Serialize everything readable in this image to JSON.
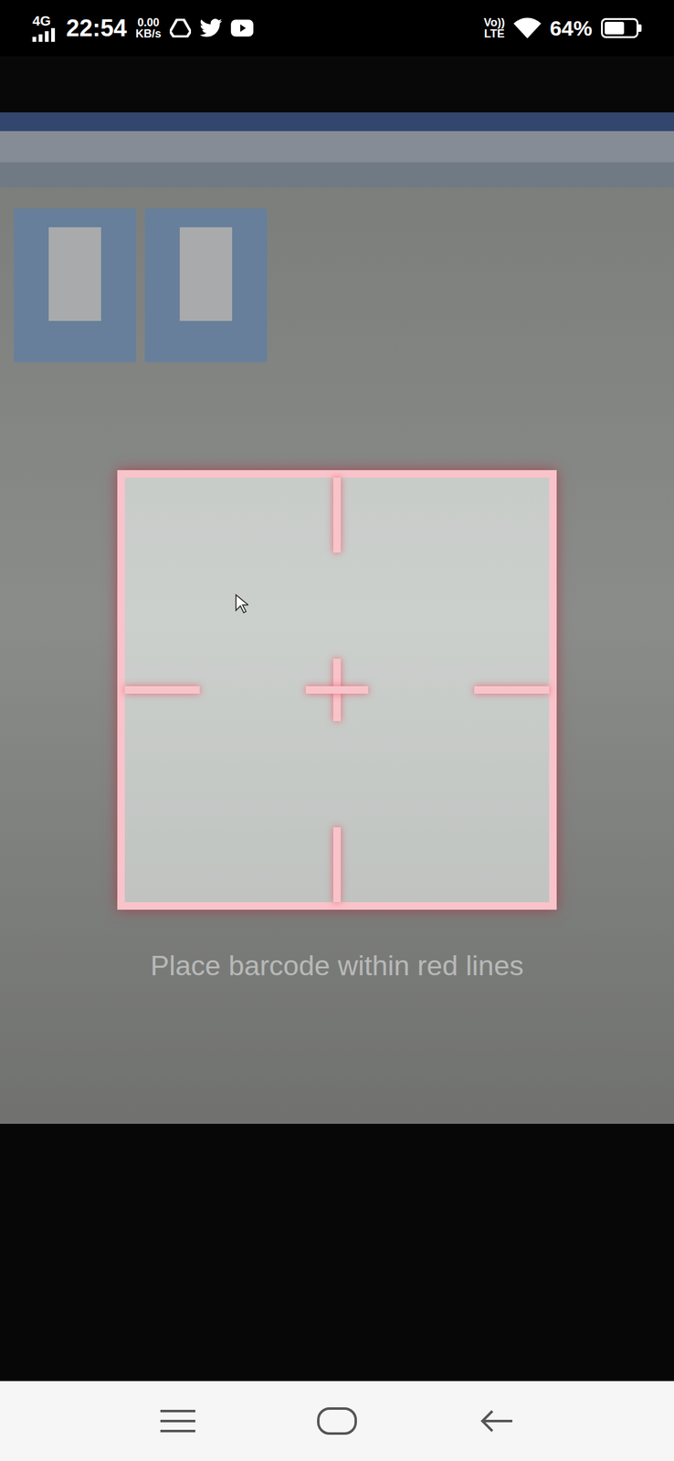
{
  "status_bar": {
    "network": "4G",
    "time": "22:54",
    "speed_value": "0.00",
    "speed_unit": "KB/s",
    "volte": "Vo))",
    "lte": "LTE",
    "battery": "64%",
    "battery_level": 0.64
  },
  "scanner": {
    "hint": "Place barcode within red lines"
  }
}
